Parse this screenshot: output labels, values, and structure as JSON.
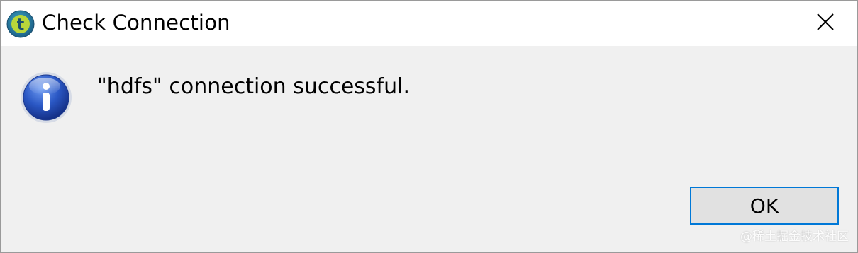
{
  "window": {
    "title": "Check Connection",
    "app_icon": "talend-t-icon",
    "close_icon": "close-icon"
  },
  "dialog": {
    "icon": "info-icon",
    "message": "\"hdfs\" connection successful.",
    "ok_label": "OK"
  },
  "watermark": {
    "text": "@稀土掘金技术社区"
  },
  "colors": {
    "titlebar_bg": "#ffffff",
    "content_bg": "#f0f0f0",
    "button_bg": "#e1e1e1",
    "button_focus_border": "#0078d7",
    "info_icon_blue": "#2a57c4"
  }
}
